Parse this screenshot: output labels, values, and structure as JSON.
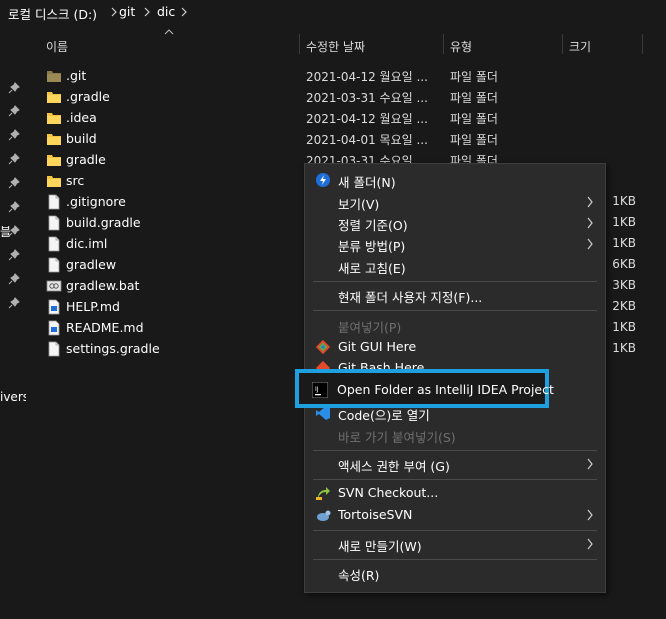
{
  "breadcrumb": {
    "items": [
      "로컬 디스크 (D:)",
      "git",
      "dic"
    ]
  },
  "left_strip": {
    "labels": [
      "블",
      "ivers"
    ]
  },
  "columns": {
    "name": "이름",
    "date": "수정한 날짜",
    "type": "유형",
    "size": "크기"
  },
  "files": [
    {
      "name": ".git",
      "date": "2021-04-12 월요일 ...",
      "type": "파일 폴더",
      "size": "",
      "icon": "folder-dark-icon"
    },
    {
      "name": ".gradle",
      "date": "2021-03-31 수요일 ...",
      "type": "파일 폴더",
      "size": "",
      "icon": "folder-icon"
    },
    {
      "name": ".idea",
      "date": "2021-04-12 월요일 ...",
      "type": "파일 폴더",
      "size": "",
      "icon": "folder-icon"
    },
    {
      "name": "build",
      "date": "2021-04-01 목요일 ...",
      "type": "파일 폴더",
      "size": "",
      "icon": "folder-icon"
    },
    {
      "name": "gradle",
      "date": "2021-03-31 수요일",
      "type": "파일 폴더",
      "size": "",
      "icon": "folder-icon"
    },
    {
      "name": "src",
      "date": "",
      "type": "",
      "size": "",
      "icon": "folder-icon"
    },
    {
      "name": ".gitignore",
      "date": "",
      "type": "",
      "size": "1KB",
      "icon": "file-icon"
    },
    {
      "name": "build.gradle",
      "date": "",
      "type": "",
      "size": "1KB",
      "icon": "file-icon"
    },
    {
      "name": "dic.iml",
      "date": "",
      "type": "",
      "size": "1KB",
      "icon": "file-icon"
    },
    {
      "name": "gradlew",
      "date": "",
      "type": "",
      "size": "6KB",
      "icon": "file-icon"
    },
    {
      "name": "gradlew.bat",
      "date": "",
      "type": "",
      "size": "3KB",
      "icon": "bat-file-icon"
    },
    {
      "name": "HELP.md",
      "date": "",
      "type": "",
      "size": "2KB",
      "icon": "md-file-icon"
    },
    {
      "name": "README.md",
      "date": "",
      "type": "",
      "size": "1KB",
      "icon": "md-file-icon"
    },
    {
      "name": "settings.gradle",
      "date": "",
      "type": "",
      "size": "1KB",
      "icon": "file-icon"
    }
  ],
  "context_menu": {
    "new_folder": "새 폴더(N)",
    "view": "보기(V)",
    "sort_by": "정렬 기준(O)",
    "group_by": "분류 방법(P)",
    "refresh": "새로 고침(E)",
    "customize_folder": "현재 폴더 사용자 지정(F)...",
    "paste": "붙여넣기(P)",
    "git_gui": "Git GUI Here",
    "git_bash": "Git Bash Here",
    "open_intellij": "Open Folder as IntelliJ IDEA Project",
    "open_code": "Code(으)로 열기",
    "paste_shortcut": "바로 가기 붙여넣기(S)",
    "give_access": "액세스 권한 부여 (G)",
    "svn_checkout": "SVN Checkout...",
    "tortoise_svn": "TortoiseSVN",
    "new": "새로 만들기(W)",
    "properties": "속성(R)"
  },
  "colors": {
    "highlight_border": "#1ea0e0",
    "folder": "#f5c542",
    "background": "#191919",
    "menu_bg": "#2b2b2b"
  }
}
